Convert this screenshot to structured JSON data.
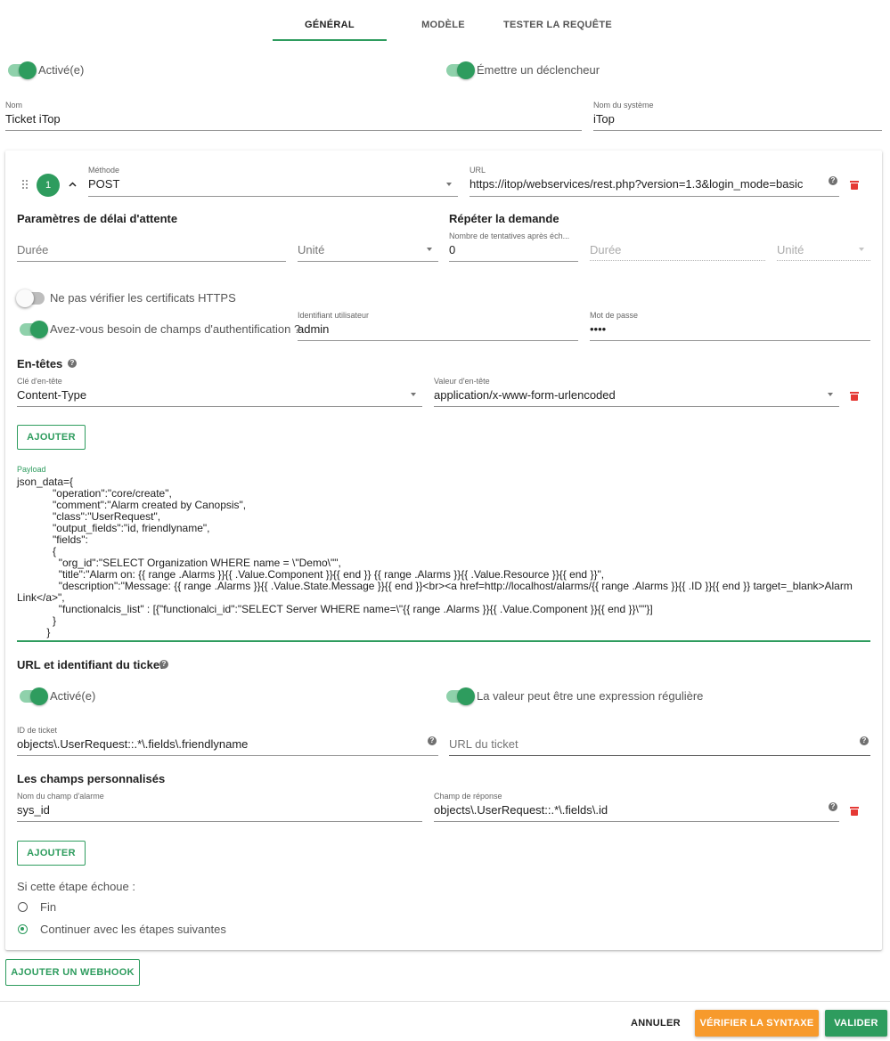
{
  "tabs": [
    {
      "label": "GÉNÉRAL"
    },
    {
      "label": "MODÈLE"
    },
    {
      "label": "TESTER LA REQUÊTE"
    }
  ],
  "general": {
    "enabled_label": "Activé(e)",
    "emit_trigger_label": "Émettre un déclencheur",
    "name": {
      "label": "Nom",
      "value": "Ticket iTop"
    },
    "system_name": {
      "label": "Nom du système",
      "value": "iTop"
    }
  },
  "step": {
    "number": "1",
    "method": {
      "label": "Méthode",
      "value": "POST"
    },
    "url": {
      "label": "URL",
      "value": "https://itop/webservices/rest.php?version=1.3&login_mode=basic"
    },
    "timeout": {
      "title": "Paramètres de délai d'attente",
      "duration_placeholder": "Durée",
      "unit_placeholder": "Unité"
    },
    "retry": {
      "title": "Répéter la demande",
      "attempts_label": "Nombre de tentatives après éch...",
      "attempts_value": "0",
      "duration_placeholder": "Durée",
      "unit_placeholder": "Unité"
    },
    "skip_https_label": "Ne pas vérifier les certificats HTTPS",
    "auth_label": "Avez-vous besoin de champs d'authentification ?",
    "username": {
      "label": "Identifiant utilisateur",
      "value": "admin"
    },
    "password": {
      "label": "Mot de passe",
      "value": "••••"
    },
    "headers": {
      "title": "En-têtes",
      "key_label": "Clé d'en-tête",
      "key_value": "Content-Type",
      "value_label": "Valeur d'en-tête",
      "value_value": "application/x-www-form-urlencoded",
      "add_label": "AJOUTER"
    },
    "payload": {
      "label": "Payload",
      "value": "json_data={\n            \"operation\":\"core/create\",\n            \"comment\":\"Alarm created by Canopsis\",\n            \"class\":\"UserRequest\",\n            \"output_fields\":\"id, friendlyname\",\n            \"fields\":\n            {\n              \"org_id\":\"SELECT Organization WHERE name = \\\"Demo\\\"\",\n              \"title\":\"Alarm on: {{ range .Alarms }}{{ .Value.Component }}{{ end }} {{ range .Alarms }}{{ .Value.Resource }}{{ end }}\",\n              \"description\":\"Message: {{ range .Alarms }}{{ .Value.State.Message }}{{ end }}<br><a href=http://localhost/alarms/{{ range .Alarms }}{{ .ID }}{{ end }} target=_blank>Alarm Link</a>\",\n              \"functionalcis_list\" : [{\"functionalci_id\":\"SELECT Server WHERE name=\\\"{{ range .Alarms }}{{ .Value.Component }}{{ end }}\\\"\"}]\n            }\n          }"
    },
    "ticket": {
      "title": "URL et identifiant du ticket",
      "enabled_label": "Activé(e)",
      "regex_label": "La valeur peut être une expression régulière",
      "id_label": "ID de ticket",
      "id_value": "objects\\.UserRequest::.*\\.fields\\.friendlyname",
      "url_placeholder": "URL du ticket"
    },
    "custom_fields": {
      "title": "Les champs personnalisés",
      "alarm_field_label": "Nom du champ d'alarme",
      "alarm_field_value": "sys_id",
      "response_label": "Champ de réponse",
      "response_value": "objects\\.UserRequest::.*\\.fields\\.id",
      "add_label": "AJOUTER"
    },
    "on_failure": {
      "label": "Si cette étape échoue :",
      "options": [
        {
          "label": "Fin",
          "selected": false
        },
        {
          "label": "Continuer avec les étapes suivantes",
          "selected": true
        }
      ]
    }
  },
  "add_webhook_label": "AJOUTER UN WEBHOOK",
  "footer": {
    "cancel_label": "ANNULER",
    "check_label": "VÉRIFIER LA SYNTAXE",
    "submit_label": "VALIDER"
  },
  "colors": {
    "accent": "#2e9c5e",
    "warning": "#f79a2c",
    "danger": "#e53935"
  },
  "icons": [
    "drag-handle-icon",
    "chevron-up-icon",
    "dropdown-caret-icon",
    "help-icon",
    "trash-icon"
  ]
}
